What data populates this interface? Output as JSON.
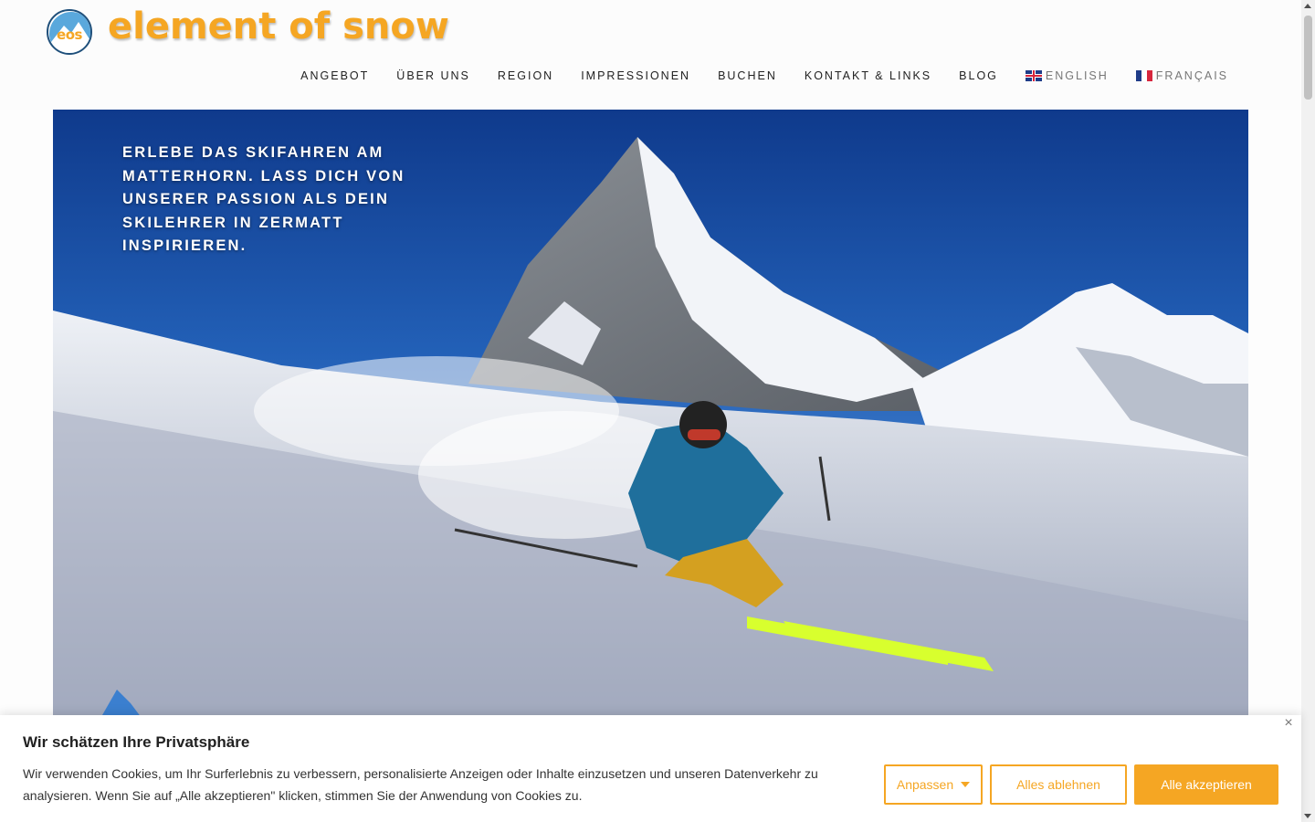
{
  "brand": {
    "logo_abbr": "eos",
    "name": "element of snow"
  },
  "nav": {
    "items": [
      {
        "label": "ANGEBOT"
      },
      {
        "label": "ÜBER UNS"
      },
      {
        "label": "REGION"
      },
      {
        "label": "IMPRESSIONEN"
      },
      {
        "label": "BUCHEN"
      },
      {
        "label": "KONTAKT & LINKS"
      },
      {
        "label": "BLOG"
      }
    ],
    "lang_en": {
      "label": "ENGLISH",
      "icon": "uk-flag-icon"
    },
    "lang_fr": {
      "label": "FRANÇAIS",
      "icon": "french-flag-icon"
    }
  },
  "hero": {
    "headline": "ERLEBE DAS SKIFAHREN AM MATTERHORN. LASS DICH VON UNSERER PASSION ALS DEIN SKILEHRER IN ZERMATT INSPIRIEREN.",
    "image": "skier-below-matterhorn"
  },
  "cookie": {
    "title": "Wir schätzen Ihre Privatsphäre",
    "text": "Wir verwenden Cookies, um Ihr Surferlebnis zu verbessern, personalisierte Anzeigen oder Inhalte einzusetzen und unseren Datenverkehr zu analysieren. Wenn Sie auf „Alle akzeptieren\" klicken, stimmen Sie der Anwendung von Cookies zu.",
    "close": "×",
    "customize": "Anpassen",
    "reject": "Alles ablehnen",
    "accept": "Alle akzeptieren"
  },
  "colors": {
    "accent": "#f5a623",
    "sky": "#2361b8",
    "text": "#222222"
  }
}
